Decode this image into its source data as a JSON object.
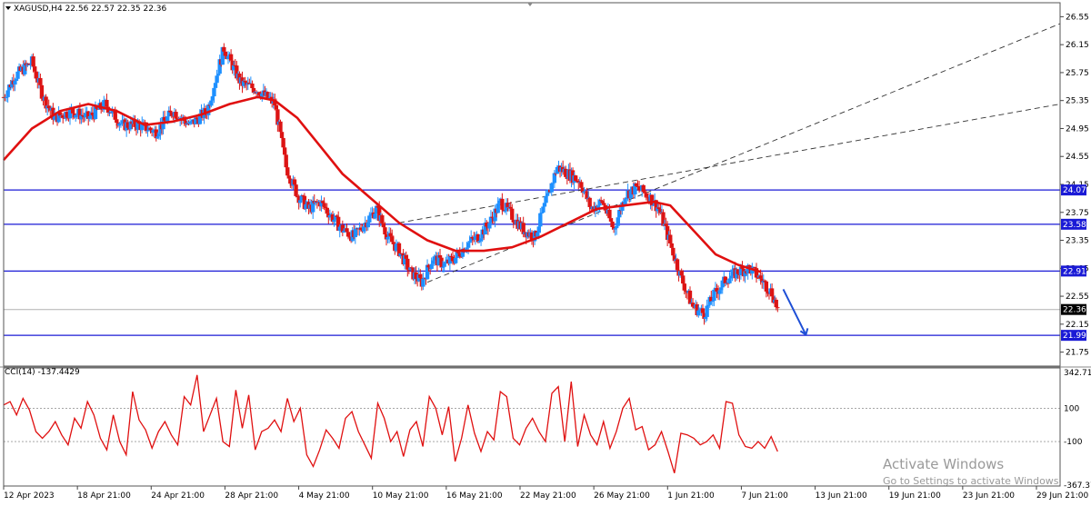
{
  "chart_data": {
    "type": "candlestick",
    "symbol_header": "XAGUSD,H4  22.56 22.57 22.35 22.36",
    "y_ticks": [
      26.55,
      26.15,
      25.75,
      25.35,
      24.95,
      24.55,
      24.15,
      23.75,
      23.35,
      22.95,
      22.55,
      22.15,
      21.75
    ],
    "y_range": [
      21.55,
      26.75
    ],
    "x_labels": [
      "12 Apr 2023",
      "18 Apr 21:00",
      "24 Apr 21:00",
      "28 Apr 21:00",
      "4 May 21:00",
      "10 May 21:00",
      "16 May 21:00",
      "22 May 21:00",
      "26 May 21:00",
      "1 Jun 21:00",
      "7 Jun 21:00",
      "13 Jun 21:00",
      "19 Jun 21:00",
      "23 Jun 21:00",
      "29 Jun 21:00"
    ],
    "levels": [
      {
        "value": 24.07,
        "label": "24.07"
      },
      {
        "value": 23.58,
        "label": "23.58"
      },
      {
        "value": 22.91,
        "label": "22.91"
      },
      {
        "value": 21.99,
        "label": "21.99"
      }
    ],
    "current_price": {
      "value": 22.36,
      "label": "22.36"
    },
    "price_path": [
      [
        0,
        25.4
      ],
      [
        2,
        25.7
      ],
      [
        5,
        25.9
      ],
      [
        7,
        25.4
      ],
      [
        9,
        25.1
      ],
      [
        12,
        25.2
      ],
      [
        15,
        25.1
      ],
      [
        18,
        25.3
      ],
      [
        21,
        25.0
      ],
      [
        24,
        25.0
      ],
      [
        27,
        24.9
      ],
      [
        30,
        25.2
      ],
      [
        33,
        25.0
      ],
      [
        36,
        25.2
      ],
      [
        39,
        26.1
      ],
      [
        42,
        25.6
      ],
      [
        45,
        25.5
      ],
      [
        48,
        25.3
      ],
      [
        50,
        24.4
      ],
      [
        52,
        24.0
      ],
      [
        54,
        23.8
      ],
      [
        56,
        23.9
      ],
      [
        58,
        23.7
      ],
      [
        60,
        23.5
      ],
      [
        62,
        23.4
      ],
      [
        64,
        23.6
      ],
      [
        66,
        23.8
      ],
      [
        68,
        23.4
      ],
      [
        70,
        23.2
      ],
      [
        72,
        22.9
      ],
      [
        74,
        22.75
      ],
      [
        76,
        23.1
      ],
      [
        78,
        23.0
      ],
      [
        80,
        23.1
      ],
      [
        82,
        23.3
      ],
      [
        84,
        23.4
      ],
      [
        86,
        23.6
      ],
      [
        88,
        23.9
      ],
      [
        90,
        23.7
      ],
      [
        92,
        23.5
      ],
      [
        94,
        23.4
      ],
      [
        96,
        23.9
      ],
      [
        98,
        24.4
      ],
      [
        100,
        24.3
      ],
      [
        102,
        24.2
      ],
      [
        104,
        23.8
      ],
      [
        106,
        23.9
      ],
      [
        108,
        23.5
      ],
      [
        110,
        24.0
      ],
      [
        112,
        24.1
      ],
      [
        114,
        24.0
      ],
      [
        116,
        23.8
      ],
      [
        118,
        23.3
      ],
      [
        120,
        22.8
      ],
      [
        122,
        22.4
      ],
      [
        124,
        22.3
      ],
      [
        126,
        22.6
      ],
      [
        128,
        22.8
      ],
      [
        130,
        22.9
      ],
      [
        132,
        22.95
      ],
      [
        134,
        22.8
      ],
      [
        136,
        22.6
      ],
      [
        137,
        22.36
      ]
    ],
    "ma_path": [
      [
        0,
        24.5
      ],
      [
        5,
        24.95
      ],
      [
        10,
        25.2
      ],
      [
        15,
        25.3
      ],
      [
        20,
        25.2
      ],
      [
        25,
        25.0
      ],
      [
        30,
        25.05
      ],
      [
        35,
        25.15
      ],
      [
        40,
        25.3
      ],
      [
        45,
        25.4
      ],
      [
        48,
        25.35
      ],
      [
        52,
        25.1
      ],
      [
        56,
        24.7
      ],
      [
        60,
        24.3
      ],
      [
        65,
        23.95
      ],
      [
        70,
        23.6
      ],
      [
        75,
        23.35
      ],
      [
        80,
        23.2
      ],
      [
        85,
        23.2
      ],
      [
        90,
        23.25
      ],
      [
        95,
        23.4
      ],
      [
        100,
        23.6
      ],
      [
        105,
        23.8
      ],
      [
        110,
        23.85
      ],
      [
        115,
        23.9
      ],
      [
        118,
        23.85
      ],
      [
        122,
        23.5
      ],
      [
        126,
        23.15
      ],
      [
        130,
        23.0
      ],
      [
        134,
        22.9
      ]
    ],
    "channel_lines": [
      {
        "p1": [
          75,
          22.75
        ],
        "p2": [
          187,
          26.45
        ]
      },
      {
        "p1": [
          70,
          23.6
        ],
        "p2": [
          187,
          25.3
        ]
      }
    ],
    "forecast_arrow": {
      "p1": [
        138,
        22.65
      ],
      "p2": [
        142,
        22.0
      ]
    },
    "x_domain": [
      0,
      187
    ],
    "cci": {
      "label": "CCI(14) -137.4429",
      "y_ticks": [
        "342.715",
        "100",
        "-100",
        "-367.374"
      ],
      "y_range": [
        -367.374,
        342.715
      ],
      "levels": [
        100,
        -100
      ],
      "values": [
        120,
        140,
        60,
        160,
        90,
        -40,
        -80,
        -40,
        20,
        -60,
        -120,
        40,
        -20,
        140,
        60,
        -80,
        -150,
        60,
        -100,
        -180,
        200,
        30,
        -30,
        -140,
        -40,
        20,
        -60,
        -120,
        170,
        120,
        300,
        -40,
        60,
        160,
        -100,
        -130,
        210,
        -20,
        180,
        -150,
        -40,
        -20,
        30,
        -40,
        160,
        20,
        100,
        -180,
        -250,
        -150,
        -30,
        -80,
        -140,
        40,
        80,
        -40,
        -120,
        -200,
        130,
        40,
        -100,
        -40,
        -190,
        -30,
        20,
        -130,
        170,
        100,
        -60,
        110,
        -220,
        -80,
        120,
        -50,
        -160,
        -40,
        -90,
        200,
        170,
        -80,
        -120,
        -20,
        40,
        -40,
        -100,
        190,
        230,
        -100,
        260,
        -130,
        60,
        -60,
        -120,
        20,
        -140,
        -40,
        100,
        160,
        -30,
        -10,
        -150,
        -120,
        -40,
        -160,
        -290,
        -50,
        -60,
        -80,
        -120,
        -100,
        -60,
        -140,
        140,
        130,
        -60,
        -130,
        -140,
        -100,
        -140,
        -70,
        -160
      ],
      "watermark": {
        "title": "Activate Windows",
        "subtitle": "Go to Settings to activate Windows."
      }
    }
  }
}
